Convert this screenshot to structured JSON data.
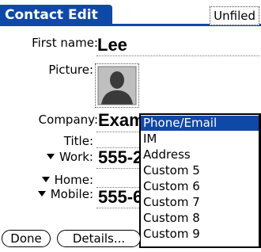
{
  "title_bar": {
    "title": "Contact Edit",
    "category": "Unfiled"
  },
  "fields": {
    "first_name": {
      "label": "First name:",
      "value": "Lee"
    },
    "picture": {
      "label": "Picture:"
    },
    "company": {
      "label": "Company:",
      "value": "Exam"
    },
    "title": {
      "label": "Title:",
      "value": ""
    },
    "work": {
      "label": "Work:",
      "value": "555-2"
    },
    "home": {
      "label": "Home:",
      "value": ""
    },
    "mobile": {
      "label": "Mobile:",
      "value": "555-6"
    }
  },
  "popup": {
    "items": [
      "Phone/Email",
      "IM",
      "Address",
      "Custom 5",
      "Custom 6",
      "Custom 7",
      "Custom 8",
      "Custom 9"
    ],
    "selected": "Phone/Email"
  },
  "buttons": {
    "done": "Done",
    "details": "Details..."
  },
  "colors": {
    "accent": "#0f49a8"
  }
}
